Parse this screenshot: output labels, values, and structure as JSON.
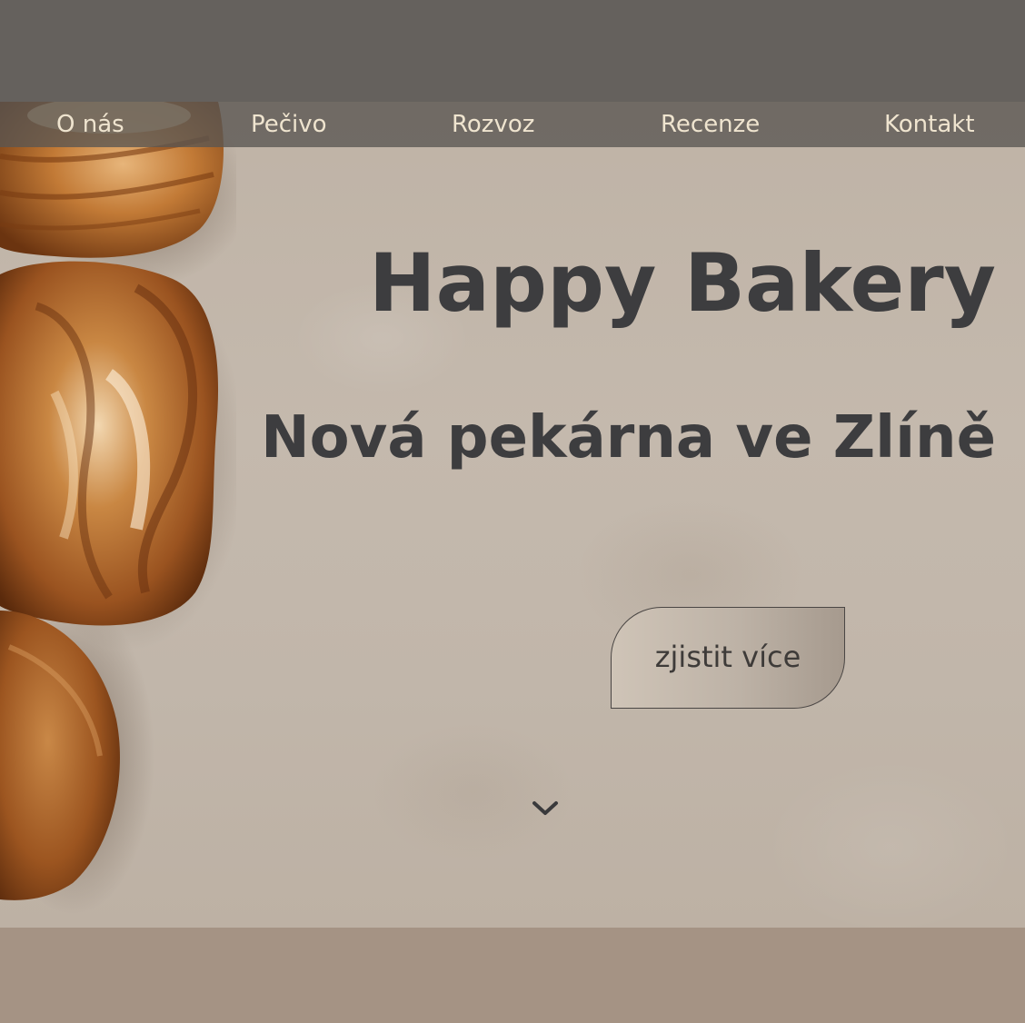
{
  "nav": {
    "items": [
      {
        "label": "O nás"
      },
      {
        "label": "Pečivo"
      },
      {
        "label": "Rozvoz"
      },
      {
        "label": "Recenze"
      },
      {
        "label": "Kontakt"
      }
    ]
  },
  "hero": {
    "title": "Happy Bakery",
    "subtitle": "Nová pekárna ve Zlíně",
    "cta_label": "zjistit více",
    "scroll_icon": "chevron-down-icon"
  },
  "colors": {
    "top_band": "#65615d",
    "nav_text": "#efe4cf",
    "heading_text": "#3d3d3f",
    "footer_band": "#a59384"
  }
}
